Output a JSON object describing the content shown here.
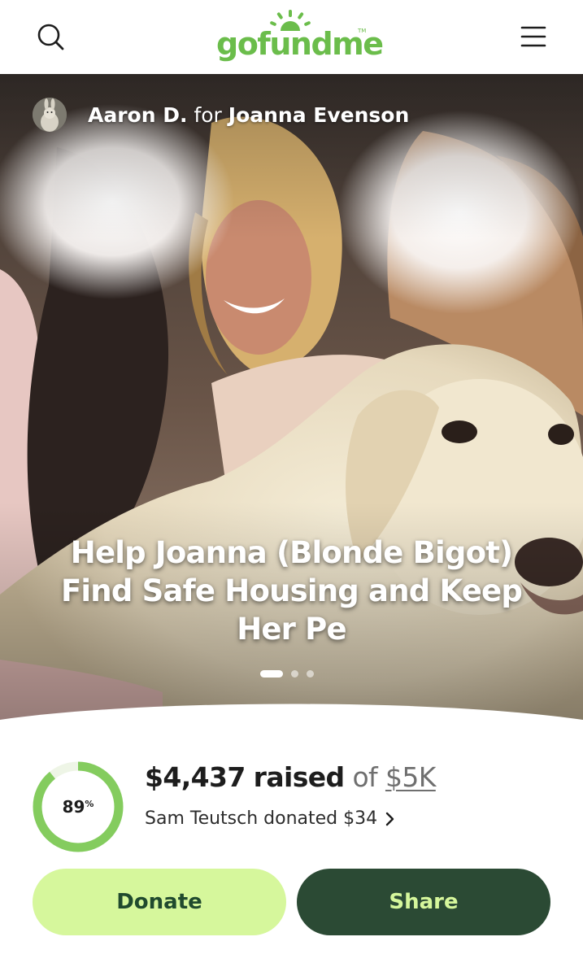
{
  "brand": {
    "name": "gofundme",
    "tm": "TM",
    "color": "#6bbd4b"
  },
  "header": {
    "search_icon": "search-icon",
    "menu_icon": "hamburger-menu-icon"
  },
  "campaign": {
    "organizer": "Aaron D.",
    "for_text": "for",
    "beneficiary": "Joanna Evenson",
    "title": "Help Joanna (Blonde Bigot) Find Safe Housing and Keep Her Pe",
    "slides": {
      "total": 3,
      "active": 0
    }
  },
  "progress": {
    "percent_value": 89,
    "percent_label": "89",
    "percent_sign": "%",
    "raised_amount": "$4,437",
    "raised_word": "raised",
    "of_word": "of",
    "goal": "$5K",
    "recent_donation": "Sam Teutsch donated $34",
    "ring_color": "#84cc5e",
    "ring_track_color": "#eef5e6"
  },
  "actions": {
    "donate_label": "Donate",
    "share_label": "Share",
    "donate_bg": "#d6f79c",
    "share_bg": "#2b4a34"
  }
}
